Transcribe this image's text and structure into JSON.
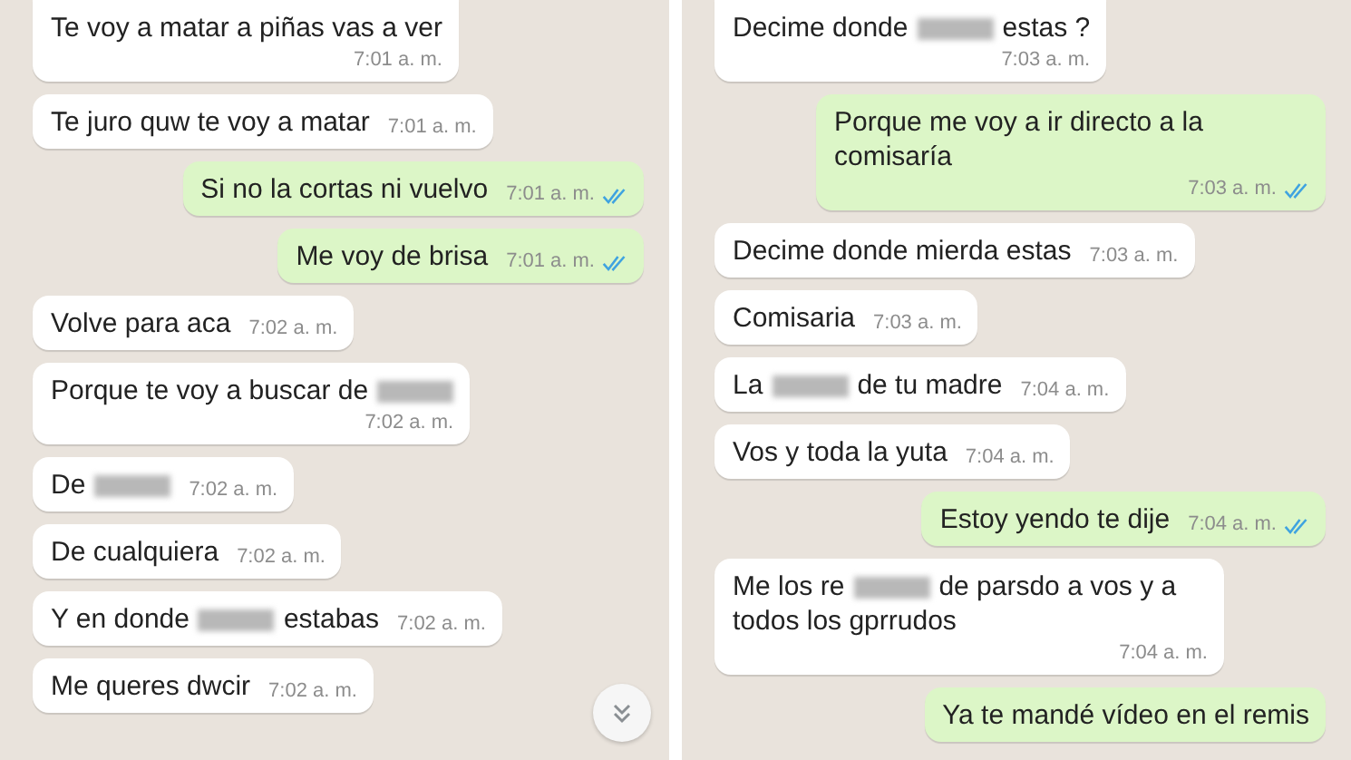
{
  "panels": [
    {
      "messages": [
        {
          "outgoing": false,
          "kind": "stacked",
          "parts": [
            {
              "kind": "text",
              "text": "Te voy a matar a piñas vas a ver"
            }
          ],
          "time": "7:01 a. m."
        },
        {
          "outgoing": false,
          "kind": "inline",
          "parts": [
            {
              "kind": "text",
              "text": "Te juro quw te voy a matar"
            }
          ],
          "time": "7:01 a. m."
        },
        {
          "outgoing": true,
          "kind": "inline",
          "parts": [
            {
              "kind": "text",
              "text": "Si no la cortas ni vuelvo"
            }
          ],
          "time": "7:01 a. m.",
          "read": true
        },
        {
          "outgoing": true,
          "kind": "inline",
          "parts": [
            {
              "kind": "text",
              "text": "Me voy de brisa"
            }
          ],
          "time": "7:01 a. m.",
          "read": true
        },
        {
          "outgoing": false,
          "kind": "inline",
          "parts": [
            {
              "kind": "text",
              "text": "Volve para aca"
            }
          ],
          "time": "7:02 a. m."
        },
        {
          "outgoing": false,
          "kind": "stacked",
          "parts": [
            {
              "kind": "text",
              "text": "Porque te voy a buscar de"
            },
            {
              "kind": "redacted"
            }
          ],
          "time": "7:02 a. m."
        },
        {
          "outgoing": false,
          "kind": "inline",
          "parts": [
            {
              "kind": "text",
              "text": "De"
            },
            {
              "kind": "redacted"
            }
          ],
          "time": "7:02 a. m."
        },
        {
          "outgoing": false,
          "kind": "inline",
          "parts": [
            {
              "kind": "text",
              "text": "De cualquiera"
            }
          ],
          "time": "7:02 a. m."
        },
        {
          "outgoing": false,
          "kind": "inline",
          "parts": [
            {
              "kind": "text",
              "text": "Y en donde"
            },
            {
              "kind": "redacted"
            },
            {
              "kind": "text",
              "text": "estabas"
            }
          ],
          "time": "7:02 a. m."
        },
        {
          "outgoing": false,
          "kind": "inline",
          "parts": [
            {
              "kind": "text",
              "text": "Me queres dwcir"
            }
          ],
          "time": "7:02 a. m."
        }
      ],
      "scroll_button": true
    },
    {
      "messages": [
        {
          "outgoing": false,
          "kind": "stacked",
          "parts": [
            {
              "kind": "text",
              "text": "Decime donde"
            },
            {
              "kind": "redacted"
            },
            {
              "kind": "text",
              "text": "estas ?"
            }
          ],
          "time": "7:03 a. m."
        },
        {
          "outgoing": true,
          "kind": "stacked",
          "parts": [
            {
              "kind": "text",
              "text": "Porque me voy a ir directo a la"
            },
            {
              "kind": "text",
              "text": "comisaría"
            }
          ],
          "time": "7:03 a. m.",
          "read": true
        },
        {
          "outgoing": false,
          "kind": "inline",
          "parts": [
            {
              "kind": "text",
              "text": "Decime donde mierda estas"
            }
          ],
          "time": "7:03 a. m."
        },
        {
          "outgoing": false,
          "kind": "inline",
          "parts": [
            {
              "kind": "text",
              "text": "Comisaria"
            }
          ],
          "time": "7:03 a. m."
        },
        {
          "outgoing": false,
          "kind": "inline",
          "parts": [
            {
              "kind": "text",
              "text": "La"
            },
            {
              "kind": "redacted"
            },
            {
              "kind": "text",
              "text": "de tu madre"
            }
          ],
          "time": "7:04 a. m."
        },
        {
          "outgoing": false,
          "kind": "inline",
          "parts": [
            {
              "kind": "text",
              "text": "Vos y toda la yuta"
            }
          ],
          "time": "7:04 a. m."
        },
        {
          "outgoing": true,
          "kind": "inline",
          "parts": [
            {
              "kind": "text",
              "text": "Estoy yendo te dije"
            }
          ],
          "time": "7:04 a. m.",
          "read": true
        },
        {
          "outgoing": false,
          "kind": "stacked",
          "parts": [
            {
              "kind": "text",
              "text": "Me los re"
            },
            {
              "kind": "redacted"
            },
            {
              "kind": "text",
              "text": "de parsdo a vos y a"
            },
            {
              "kind": "text",
              "text": "todos los gprrudos"
            }
          ],
          "time": "7:04 a. m."
        },
        {
          "outgoing": true,
          "kind": "inline",
          "parts": [
            {
              "kind": "text",
              "text": "Ya te mandé vídeo en el remis"
            }
          ]
        }
      ],
      "scroll_button": false
    }
  ]
}
